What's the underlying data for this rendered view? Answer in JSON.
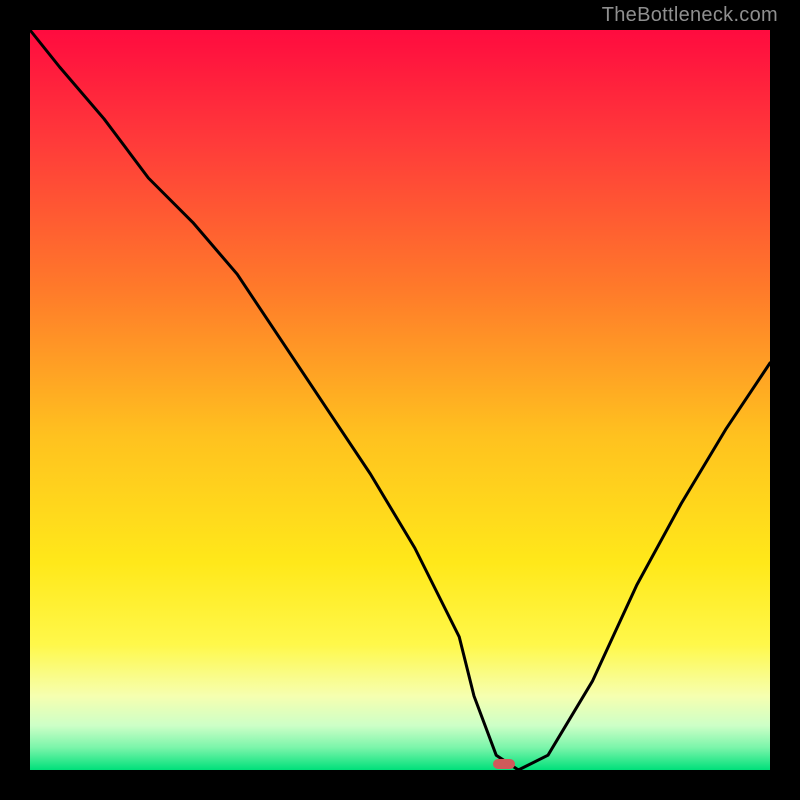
{
  "watermark": "TheBottleneck.com",
  "marker": {
    "x_pct": 64,
    "y_pct": 99.2,
    "color": "#d05a5a"
  },
  "chart_data": {
    "type": "line",
    "title": "",
    "xlabel": "",
    "ylabel": "",
    "xlim": [
      0,
      100
    ],
    "ylim": [
      0,
      100
    ],
    "grid": false,
    "series": [
      {
        "name": "bottleneck-curve",
        "x": [
          0,
          4,
          10,
          16,
          22,
          28,
          34,
          40,
          46,
          52,
          58,
          60,
          63,
          66,
          70,
          76,
          82,
          88,
          94,
          100
        ],
        "y": [
          100,
          95,
          88,
          80,
          74,
          67,
          58,
          49,
          40,
          30,
          18,
          10,
          2,
          0,
          2,
          12,
          25,
          36,
          46,
          55
        ]
      }
    ],
    "background_gradient": {
      "type": "vertical",
      "stops": [
        {
          "pos": 0.0,
          "color": "#ff0b3f"
        },
        {
          "pos": 0.15,
          "color": "#ff3a3a"
        },
        {
          "pos": 0.35,
          "color": "#ff7a2a"
        },
        {
          "pos": 0.55,
          "color": "#ffc21f"
        },
        {
          "pos": 0.72,
          "color": "#ffe81a"
        },
        {
          "pos": 0.83,
          "color": "#fff84a"
        },
        {
          "pos": 0.9,
          "color": "#f6ffb0"
        },
        {
          "pos": 0.94,
          "color": "#cdffc7"
        },
        {
          "pos": 0.97,
          "color": "#7af5aa"
        },
        {
          "pos": 1.0,
          "color": "#00e07a"
        }
      ]
    },
    "marker_point": {
      "x": 64,
      "y": 0.8
    }
  }
}
